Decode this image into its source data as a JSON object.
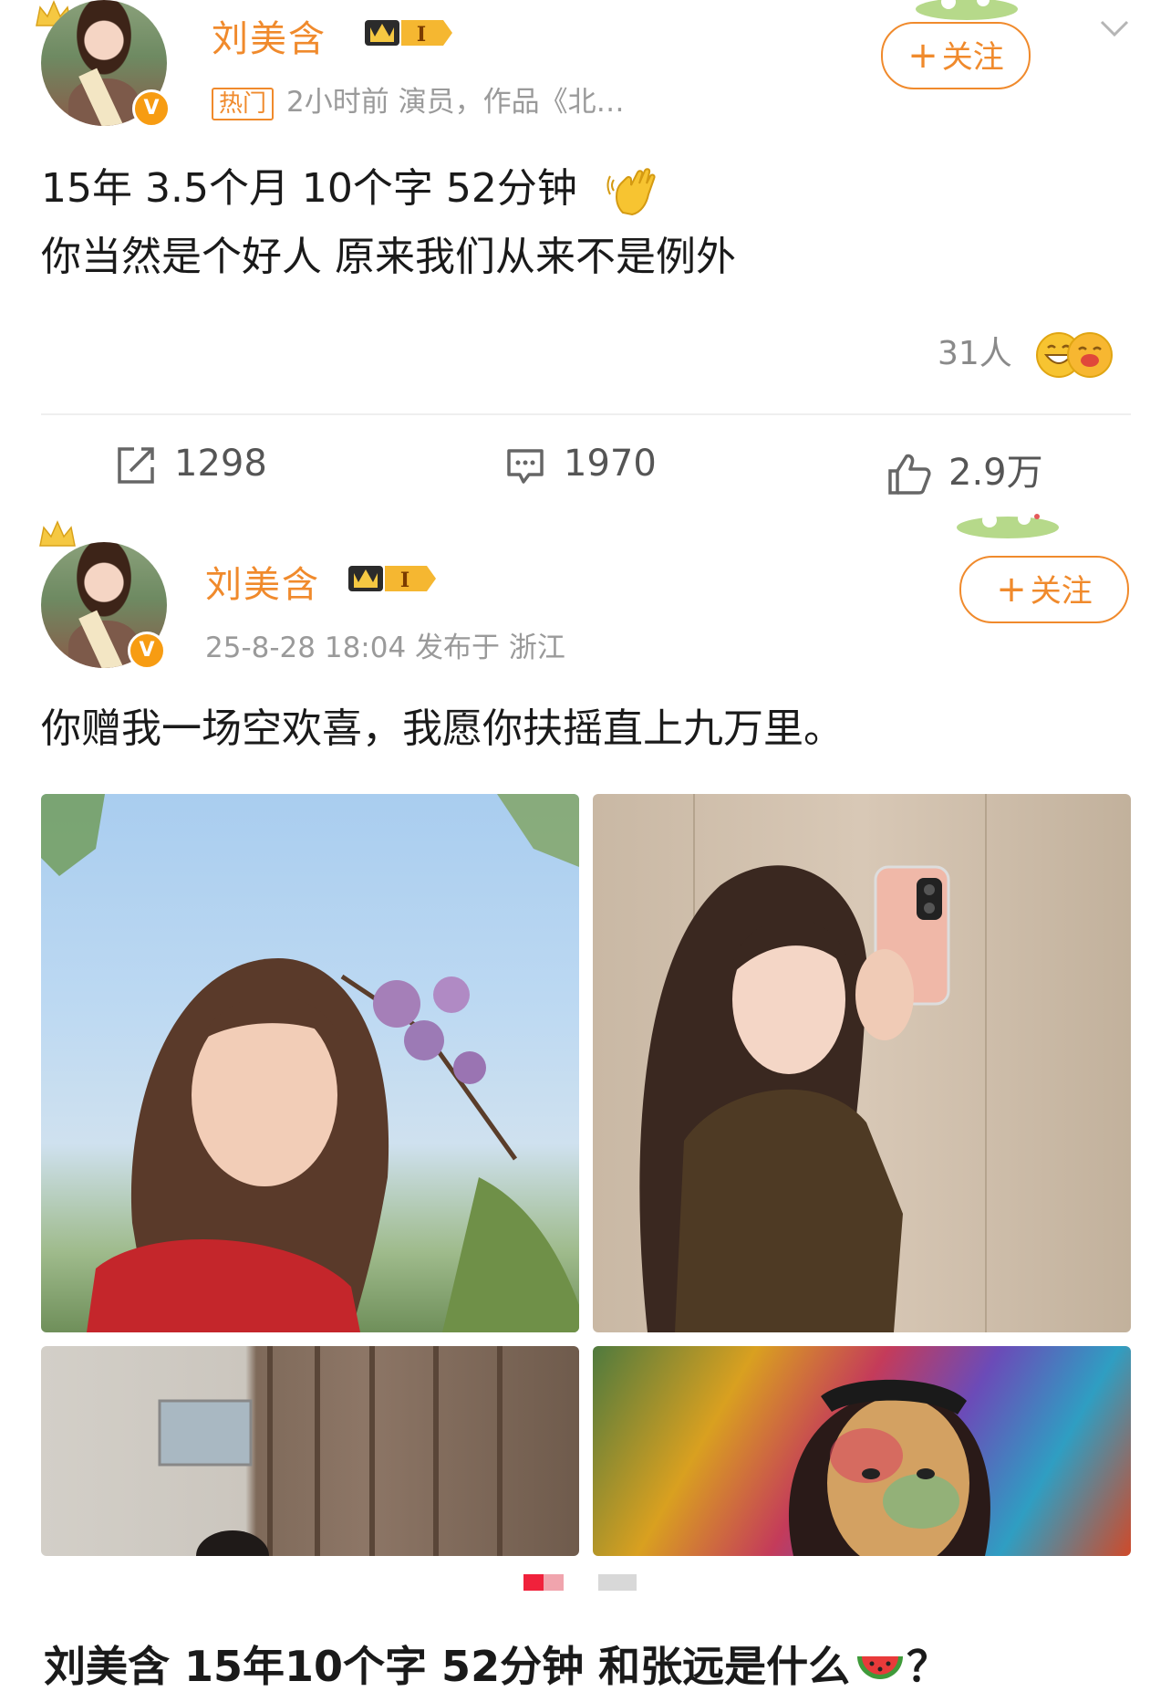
{
  "post1": {
    "username": "刘美含",
    "level": "I",
    "hot_tag": "热门",
    "meta": "2小时前  演员，作品《北…",
    "follow_label": "关注",
    "text_line1": "15年 3.5个月 10个字 52分钟",
    "text_line2": "你当然是个好人   原来我们从来不是例外",
    "reactors": "31人",
    "repost_count": "1298",
    "comment_count": "1970",
    "like_count": "2.9万"
  },
  "post2": {
    "username": "刘美含",
    "level": "I",
    "meta": "25-8-28 18:04  发布于 浙江",
    "follow_label": "关注",
    "text": "你赠我一场空欢喜，我愿你扶摇直上九万里。"
  },
  "carousel": {
    "active_index": 0,
    "total": 2
  },
  "bottom_caption": "刘美含 15年10个字 52分钟 和张远是什么",
  "bottom_caption_suffix": "？",
  "colors": {
    "accent": "#f08a2c",
    "verified": "#f79c12",
    "carousel_active": "#f0213b"
  }
}
